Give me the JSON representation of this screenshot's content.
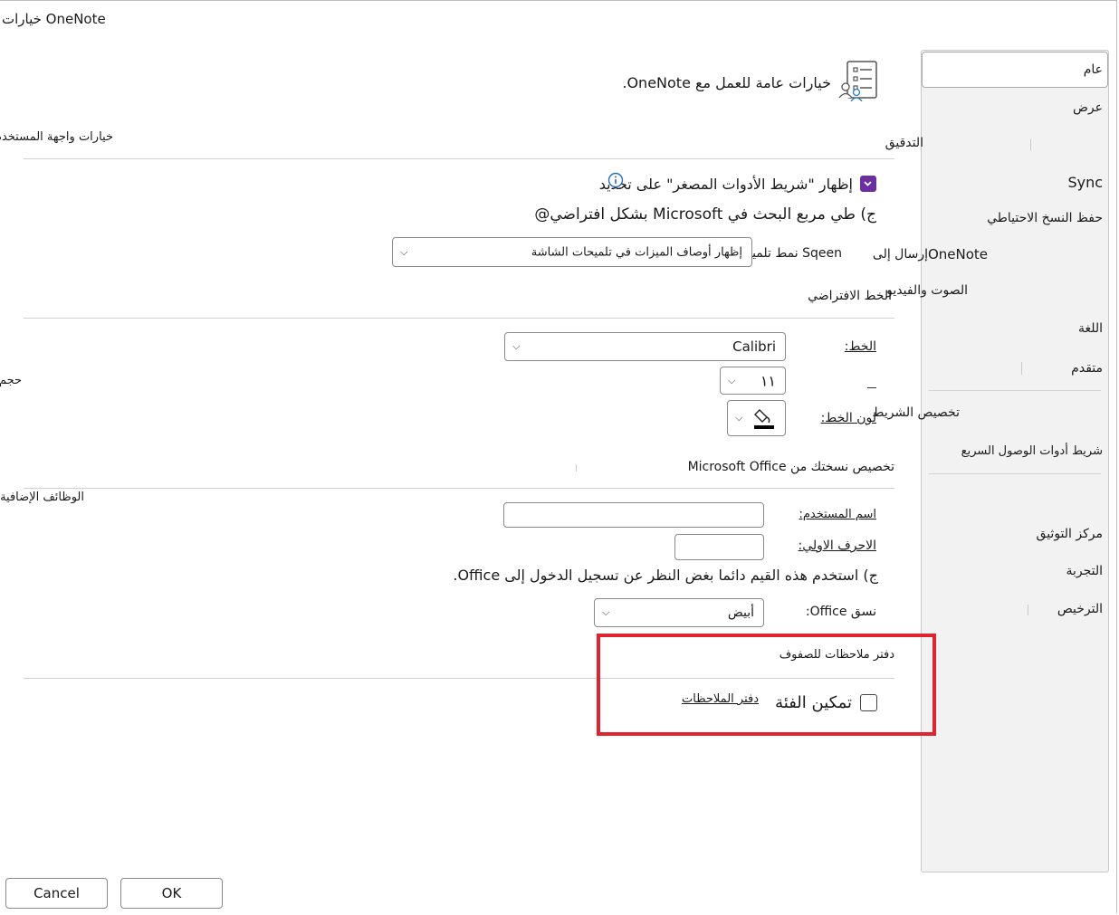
{
  "window": {
    "title": "خيارات OneNote"
  },
  "sidebar": {
    "items": [
      {
        "label": "عام"
      },
      {
        "label": "عرض"
      },
      {
        "label": "التدقيق"
      },
      {
        "label": "Sync"
      },
      {
        "label": "حفظ النسخ الاحتياطي"
      },
      {
        "label": "إرسال إلى"
      },
      {
        "label": "OneNote"
      },
      {
        "label": "الصوت والفيديو"
      },
      {
        "label": "اللغة"
      },
      {
        "label": "متقدم"
      },
      {
        "label": "تخصيص الشريط"
      },
      {
        "label": "شريط أدوات الوصول السريع"
      },
      {
        "label": "مركز التوثيق"
      },
      {
        "label": "التجربة"
      },
      {
        "label": "الترخيص"
      }
    ]
  },
  "header": {
    "description": "خيارات عامة للعمل مع OneNote.",
    "icon": "options-general-icon"
  },
  "ui_section": {
    "title": "خيارات واجهة المستخدم",
    "mini_toolbar_label": "إظهار \"شريط الأدوات المصغر\" على تحديد",
    "mini_toolbar_checked": true,
    "search_label": "ج) طي مربع البحث في Microsoft بشكل افتراضي@",
    "screentip_label": "Sqeen نمط تلميح:",
    "screentip_value": "إظهار أوصاف الميزات في تلميحات الشاشة"
  },
  "font_section": {
    "title": "الخط الافتراضي",
    "font_label": "الخط:",
    "font_value": "Calibri",
    "size_label": "حجم:",
    "size_value": "١١",
    "color_label": "لون الخط:"
  },
  "office_section": {
    "title": "تخصيص نسختك من Microsoft Office",
    "addins_label": "الوظائف الإضافية",
    "username_label": "اسم المستخدم:",
    "username_value": "",
    "initials_label": "الاحرف الاولي:",
    "initials_value": "",
    "always_use_label": "ج) استخدم هذه القيم دائما بغض النظر عن تسجيل الدخول إلى Office.",
    "theme_label": "نسق Office:",
    "theme_value": "أبيض"
  },
  "class_section": {
    "title": "دفتر ملاحظات للصفوف",
    "enable_label": "تمكين الفئة",
    "notebook_label": "دفتر الملاحظات",
    "enable_checked": false
  },
  "footer": {
    "ok_label": "OK",
    "cancel_label": "Cancel"
  },
  "colors": {
    "accent": "#6b2fa0",
    "highlight": "#e0242f"
  }
}
